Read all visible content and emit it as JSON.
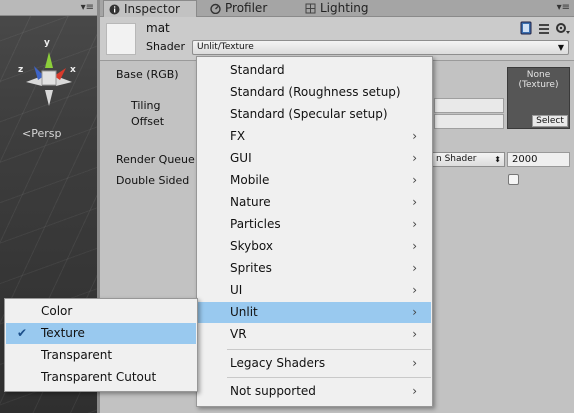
{
  "scene": {
    "menu_glyph": "▾≡",
    "gizmo": {
      "y": "y",
      "z": "z",
      "x": "x"
    },
    "persp_label": "<Persp"
  },
  "tabs": [
    {
      "label": "Inspector",
      "icon": "info-icon",
      "active": true
    },
    {
      "label": "Profiler",
      "icon": "profiler-icon",
      "active": false
    },
    {
      "label": "Lighting",
      "icon": "lighting-icon",
      "active": false
    }
  ],
  "tab_menu_glyph": "▾≡",
  "material": {
    "name": "mat",
    "shader_label": "Shader",
    "shader_value": "Unlit/Texture"
  },
  "properties": {
    "base_label": "Base (RGB)",
    "tiling_label": "Tiling",
    "offset_label": "Offset",
    "texture_none": "None\n(Texture)",
    "texture_select": "Select",
    "render_queue_label": "Render Queue",
    "render_queue_mode": "n Shader",
    "render_queue_value": "2000",
    "double_sided_label": "Double Sided"
  },
  "shader_menu": [
    {
      "label": "Standard",
      "sub": false
    },
    {
      "label": "Standard (Roughness setup)",
      "sub": false
    },
    {
      "label": "Standard (Specular setup)",
      "sub": false
    },
    {
      "label": "FX",
      "sub": true
    },
    {
      "label": "GUI",
      "sub": true
    },
    {
      "label": "Mobile",
      "sub": true
    },
    {
      "label": "Nature",
      "sub": true
    },
    {
      "label": "Particles",
      "sub": true
    },
    {
      "label": "Skybox",
      "sub": true
    },
    {
      "label": "Sprites",
      "sub": true
    },
    {
      "label": "UI",
      "sub": true
    },
    {
      "label": "Unlit",
      "sub": true,
      "highlighted": true
    },
    {
      "label": "VR",
      "sub": true
    },
    {
      "label": "Legacy Shaders",
      "sub": true
    },
    {
      "label": "Not supported",
      "sub": true
    }
  ],
  "unlit_menu": [
    {
      "label": "Color",
      "checked": false
    },
    {
      "label": "Texture",
      "checked": true,
      "highlighted": true
    },
    {
      "label": "Transparent",
      "checked": false
    },
    {
      "label": "Transparent Cutout",
      "checked": false
    }
  ],
  "colors": {
    "highlight": "#99c9ef",
    "panel": "#c2c2c2",
    "menu_bg": "#f0f0f0"
  }
}
